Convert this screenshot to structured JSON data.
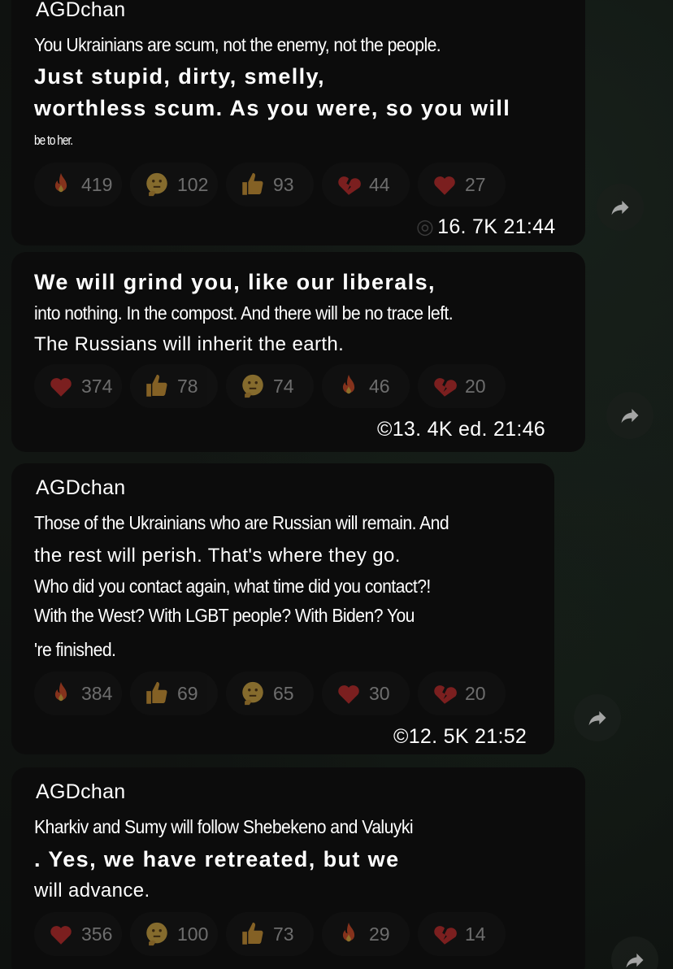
{
  "messages": [
    {
      "author": "AGDchan",
      "lines": [
        "You Ukrainians are scum, not the enemy, not the people.",
        "Just stupid, dirty, smelly,",
        "worthless scum. As you were, so you will",
        "be to her."
      ],
      "reactions": [
        {
          "icon": "fire-icon",
          "count": "419"
        },
        {
          "icon": "thinking-face-icon",
          "count": "102"
        },
        {
          "icon": "thumbs-up-icon",
          "count": "93"
        },
        {
          "icon": "broken-heart-icon",
          "count": "44"
        },
        {
          "icon": "heart-icon",
          "count": "27"
        }
      ],
      "meta": "16. 7K 21:44"
    },
    {
      "author": "",
      "lines": [
        "We will grind you, like our liberals,",
        "into nothing. In the compost. And there will be no trace left.",
        "The Russians will inherit the earth."
      ],
      "reactions": [
        {
          "icon": "heart-icon",
          "count": "374"
        },
        {
          "icon": "thumbs-up-icon",
          "count": "78"
        },
        {
          "icon": "thinking-face-icon",
          "count": "74"
        },
        {
          "icon": "fire-icon",
          "count": "46"
        },
        {
          "icon": "broken-heart-icon",
          "count": "20"
        }
      ],
      "meta": "©13. 4K ed. 21:46"
    },
    {
      "author": "AGDchan",
      "lines": [
        "Those of the Ukrainians who are Russian will remain. And",
        "the rest will perish. That's where they go.",
        "Who did you contact again, what time did you contact?!",
        "With the West? With LGBT people? With Biden? You",
        "'re finished."
      ],
      "reactions": [
        {
          "icon": "fire-icon",
          "count": "384"
        },
        {
          "icon": "thumbs-up-icon",
          "count": "69"
        },
        {
          "icon": "thinking-face-icon",
          "count": "65"
        },
        {
          "icon": "heart-icon",
          "count": "30"
        },
        {
          "icon": "broken-heart-icon",
          "count": "20"
        }
      ],
      "meta": "©12. 5K 21:52"
    },
    {
      "author": "AGDchan",
      "lines": [
        "Kharkiv and Sumy will follow Shebekeno and Valuyki",
        ". Yes, we have retreated, but we",
        "will advance."
      ],
      "reactions": [
        {
          "icon": "heart-icon",
          "count": "356"
        },
        {
          "icon": "thinking-face-icon",
          "count": "100"
        },
        {
          "icon": "thumbs-up-icon",
          "count": "73"
        },
        {
          "icon": "fire-icon",
          "count": "29"
        },
        {
          "icon": "broken-heart-icon",
          "count": "14"
        }
      ]
    }
  ],
  "colors": {
    "background": "#101311",
    "bubble": "#0c0c0c",
    "fire": "#e8512a",
    "heart": "#d62f2f",
    "thumbs": "#e7a83a",
    "thinking": "#e9b949"
  }
}
